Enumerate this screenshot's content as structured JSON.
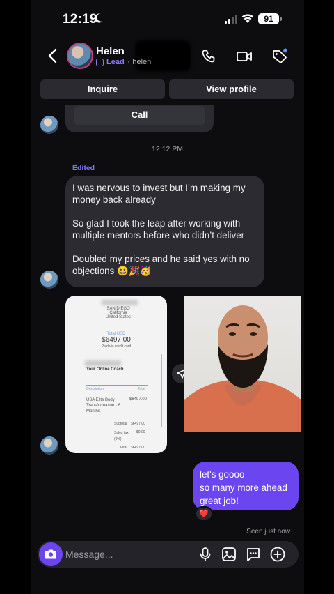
{
  "status": {
    "time": "12:19",
    "battery": "91"
  },
  "header": {
    "name": "Helen",
    "badge": "Lead",
    "separator": "·",
    "handle": "helen"
  },
  "actions": {
    "inquire": "Inquire",
    "view_profile": "View profile"
  },
  "chat": {
    "card_call": "Call",
    "timestamp": "12:12 PM",
    "edited": "Edited",
    "message_paragraphs": [
      "I was nervous to invest but I’m making my money back already",
      "So glad I took the leap after working with multiple mentors before who didn’t deliver",
      "Doubled my prices and he said yes with no objections 😀🎉🥳"
    ],
    "receipt": {
      "address": "SAN DIEGO California United States",
      "total_label": "Total USD",
      "amount": "$6497.00",
      "paid_via": "Paid via credit card",
      "payee": "Your Online Coach",
      "col_description": "Description",
      "col_total": "Total",
      "item": "USA Elite Body Transformation - 6 Months",
      "item_price": "$6497.00",
      "subtotal_label": "Subtotal",
      "subtotal": "$6497.00",
      "tax_label": "Sales tax (0%)",
      "tax": "$0.00",
      "total_row_label": "Total",
      "total_row": "$6497.00"
    },
    "outgoing": [
      "let's goooo",
      "so many more ahead",
      "great job!"
    ],
    "reaction": "❤️",
    "seen": "Seen just now"
  },
  "composer": {
    "placeholder": "Message..."
  },
  "colors": {
    "accent": "#6a45f0",
    "lead": "#8b7cf6",
    "bubble_in": "#2b2b31",
    "background": "#0d0d10"
  }
}
